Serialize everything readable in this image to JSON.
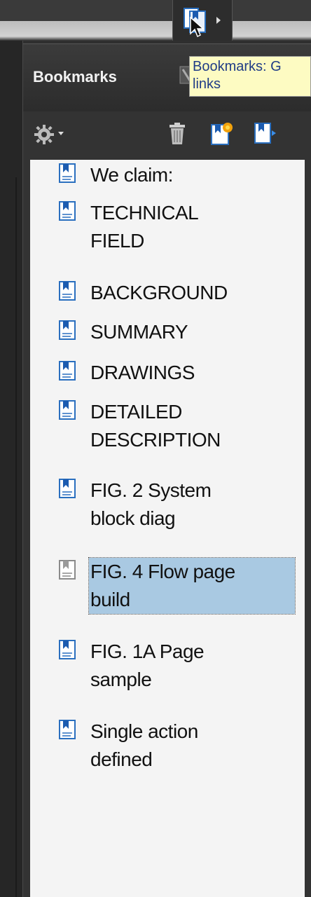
{
  "panel": {
    "title": "Bookmarks",
    "tooltip_line1": "Bookmarks: G",
    "tooltip_line2": "links"
  },
  "toolbar": {
    "options_icon": "gear-icon",
    "delete_icon": "trash-icon",
    "new_bookmark_icon": "new-bookmark-icon",
    "expand_icon": "expand-bookmark-icon"
  },
  "bookmarks": [
    {
      "line1": "We claim:",
      "line2": "",
      "selected": false
    },
    {
      "line1": "TECHNICAL",
      "line2": "FIELD",
      "selected": false
    },
    {
      "line1": "BACKGROUND",
      "line2": "",
      "selected": false
    },
    {
      "line1": "SUMMARY",
      "line2": "",
      "selected": false
    },
    {
      "line1": "DRAWINGS",
      "line2": "",
      "selected": false
    },
    {
      "line1": "DETAILED",
      "line2": "DESCRIPTION",
      "selected": false
    },
    {
      "line1": "FIG. 2 System",
      "line2": "block diag",
      "selected": false
    },
    {
      "line1": "FIG. 4 Flow page",
      "line2": "build",
      "selected": true
    },
    {
      "line1": "FIG. 1A Page",
      "line2": "sample",
      "selected": false
    },
    {
      "line1": "Single action",
      "line2": "defined",
      "selected": false
    }
  ],
  "colors": {
    "accent_selected": "#a9c9e2",
    "tooltip_bg": "#fdfbc2",
    "tooltip_text": "#203c86"
  }
}
